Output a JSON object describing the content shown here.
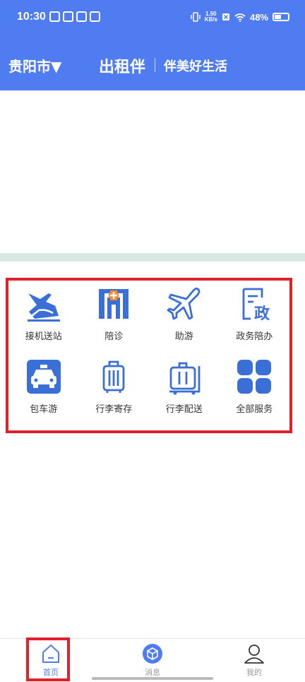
{
  "status_bar": {
    "time": "10:30",
    "net_speed": "1.50",
    "net_unit": "KB/s",
    "battery": "48%",
    "battery_level": 0.48
  },
  "header": {
    "city": "贵阳市▼",
    "app_name": "出租伴",
    "slogan": "伴美好生活",
    "accent_color": "#4f7cf0"
  },
  "services": [
    {
      "label": "接机送站",
      "icon": "plane-landing-train-icon"
    },
    {
      "label": "陪诊",
      "icon": "hospital-icon"
    },
    {
      "label": "助游",
      "icon": "airplane-icon"
    },
    {
      "label": "政务陪办",
      "icon": "government-document-icon"
    },
    {
      "label": "包车游",
      "icon": "taxi-icon"
    },
    {
      "label": "行李寄存",
      "icon": "luggage-icon"
    },
    {
      "label": "行李配送",
      "icon": "luggage-cart-icon"
    },
    {
      "label": "全部服务",
      "icon": "all-services-grid-icon"
    }
  ],
  "tabbar": {
    "home": "首页",
    "messages": "消息",
    "profile": "我的"
  }
}
